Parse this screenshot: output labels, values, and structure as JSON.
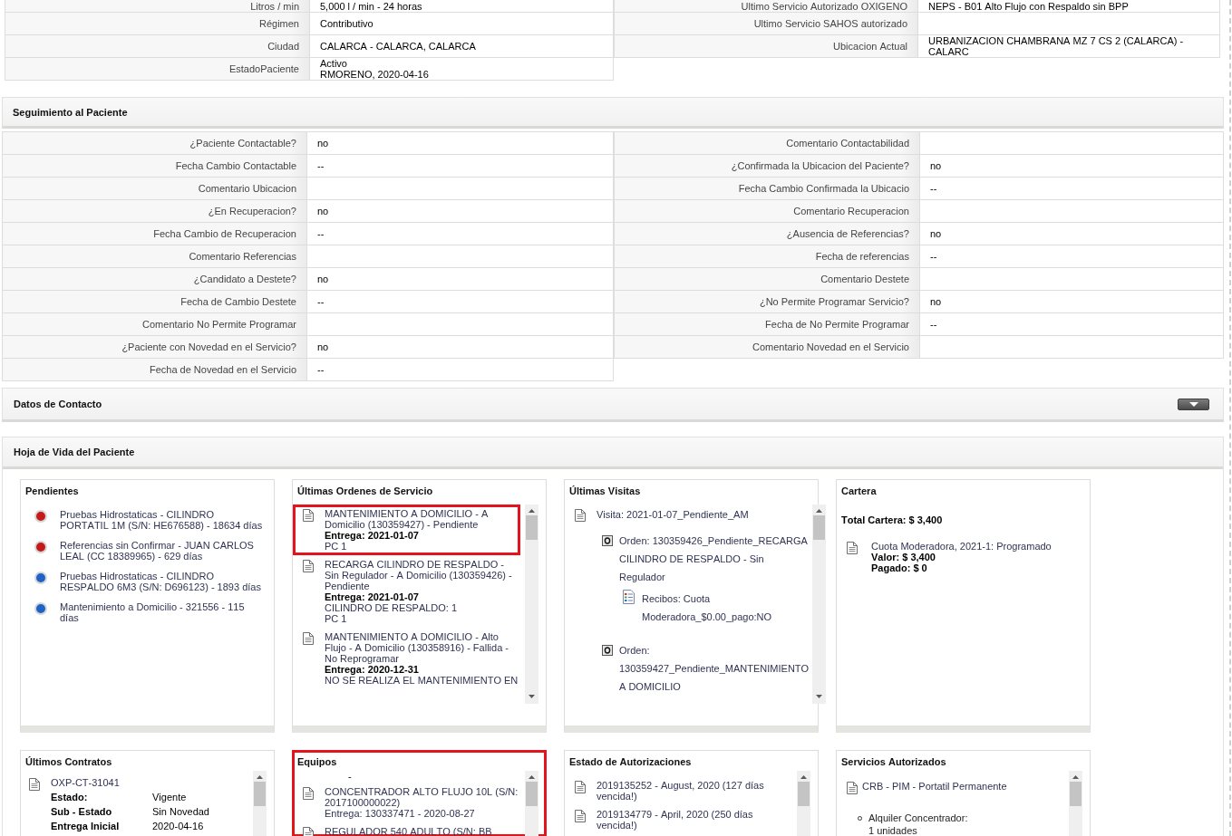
{
  "patient_info": {
    "left": [
      {
        "label": "Litros / min",
        "value": "5,000 l / min - 24 horas"
      },
      {
        "label": "Régimen",
        "value": "Contributivo"
      },
      {
        "label": "Ciudad",
        "value": "CALARCA - CALARCA, CALARCA"
      },
      {
        "label": "EstadoPaciente",
        "value": "Activo\nRMORENO, 2020-04-16"
      }
    ],
    "right": [
      {
        "label": "Ultimo Servicio Autorizado OXIGENO",
        "value": "NEPS - B01 Alto Flujo con Respaldo sin BPP"
      },
      {
        "label": "Ultimo Servicio SAHOS autorizado"
      },
      {
        "label": "Ubicacion Actual",
        "value": "URBANIZACION CHAMBRANA MZ 7 CS 2 (CALARCA) - CALARC"
      }
    ]
  },
  "seguimiento": {
    "title": "Seguimiento al Paciente",
    "left": [
      {
        "label": "¿Paciente Contactable?",
        "value": "no"
      },
      {
        "label": "Fecha Cambio Contactable",
        "value": "--"
      },
      {
        "label": "Comentario Ubicacion"
      },
      {
        "label": "¿En Recuperacion?",
        "value": "no"
      },
      {
        "label": "Fecha Cambio de Recuperacion",
        "value": "--"
      },
      {
        "label": "Comentario Referencias"
      },
      {
        "label": "¿Candidato a Destete?",
        "value": "no"
      },
      {
        "label": "Fecha de Cambio Destete",
        "value": "--"
      },
      {
        "label": "Comentario No Permite Programar"
      },
      {
        "label": "¿Paciente con Novedad en el Servicio?",
        "value": "no"
      },
      {
        "label": "Fecha de Novedad en el Servicio",
        "value": "--"
      }
    ],
    "right": [
      {
        "label": "Comentario Contactabilidad"
      },
      {
        "label": "¿Confirmada la Ubicacion del Paciente?",
        "value": "no"
      },
      {
        "label": "Fecha Cambio Confirmada la Ubicacio",
        "value": "--"
      },
      {
        "label": "Comentario Recuperacion"
      },
      {
        "label": "¿Ausencia de Referencias?",
        "value": "no"
      },
      {
        "label": "Fecha de referencias",
        "value": "--"
      },
      {
        "label": "Comentario Destete"
      },
      {
        "label": "¿No Permite Programar Servicio?",
        "value": "no"
      },
      {
        "label": "Fecha de No Permite Programar",
        "value": "--"
      },
      {
        "label": "Comentario Novedad en el Servicio"
      }
    ]
  },
  "datos_contacto": {
    "title": "Datos de Contacto",
    "expanded": false
  },
  "hoja_de_vida": {
    "title": "Hoja de Vida del Paciente",
    "panels": [
      {
        "title": "Pendientes",
        "kind": "status_list",
        "highlighted": false,
        "scrollable": false,
        "items": [
          {
            "text": "Pruebas Hidrostaticas - CILINDRO PORTATIL 1M (S/N: HE676588) - 18634 días",
            "color": "#c41a1a"
          },
          {
            "text": "Referencias sin Confirmar - JUAN CARLOS LEAL (CC 18389965) - 629 días",
            "color": "#c41a1a"
          },
          {
            "text": "Pruebas Hidrostaticas - CILINDRO RESPALDO 6M3 (S/N: D696123) - 1893 días",
            "color": "#1f63c6"
          },
          {
            "text": "Mantenimiento a Domicilio - 321556 - 115 días",
            "color": "#1f63c6"
          }
        ]
      },
      {
        "title": "Últimas Ordenes de Servicio",
        "kind": "document_list",
        "highlighted": false,
        "scrollable": true,
        "items": [
          {
            "title": "MANTENIMIENTO A DOMICILIO - A Domicilio (130359427) - Pendiente",
            "details": [
              {
                "text": "Entrega: 2021-01-07",
                "bold": true
              },
              {
                "text": "PC 1",
                "bold": false
              }
            ],
            "highlighted": true
          },
          {
            "title": "RECARGA CILINDRO DE RESPALDO - Sin Regulador - A Domicilio (130359426) - Pendiente",
            "details": [
              {
                "text": "Entrega: 2021-01-07",
                "bold": true
              },
              {
                "text": "CILINDRO DE RESPALDO: 1",
                "bold": false
              },
              {
                "text": "PC 1",
                "bold": false
              }
            ],
            "highlighted": false
          },
          {
            "title": "MANTENIMIENTO A DOMICILIO - Alto Flujo - A Domicilio (130358916) - Fallida - No Reprogramar",
            "details": [
              {
                "text": "Entrega: 2020-12-31",
                "bold": true
              },
              {
                "text": "NO SE REALIZA EL MANTENIMIENTO EN",
                "bold": false
              }
            ],
            "highlighted": false
          }
        ]
      },
      {
        "title": "Últimas Visitas",
        "kind": "visit_tree",
        "highlighted": false,
        "scrollable": true,
        "items": [
          {
            "kind": "visit",
            "text": "Visita: 2021-01-07_Pendiente_AM",
            "children": [
              {
                "kind": "order",
                "text": "Orden: 130359426_Pendiente_RECARGA CILINDRO DE RESPALDO - Sin Regulador",
                "children": [
                  {
                    "kind": "receipt",
                    "text": "Recibos: Cuota Moderadora_$0.00_pago:NO"
                  }
                ]
              },
              {
                "kind": "order",
                "text": "Orden: 130359427_Pendiente_MANTENIMIENTO A DOMICILIO"
              }
            ]
          }
        ]
      },
      {
        "title": "Cartera",
        "kind": "balance",
        "highlighted": false,
        "scrollable": false,
        "total": "Total Cartera: $ 3,400",
        "items": [
          {
            "title": "Cuota Moderadora, 2021-1: Programado",
            "details": [
              {
                "text": "Valor: $ 3,400",
                "bold": true
              },
              {
                "text": "Pagado: $ 0",
                "bold": true
              }
            ]
          }
        ]
      },
      {
        "title": "Últimos Contratos",
        "kind": "contract_list",
        "highlighted": false,
        "scrollable": true,
        "items": [
          {
            "title": "OXP-CT-31041",
            "fields": [
              {
                "label": "Estado:",
                "value": "Vigente"
              },
              {
                "label": "Sub - Estado",
                "value": "Sin Novedad"
              },
              {
                "label": "Entrega Inicial",
                "value": "2020-04-16"
              }
            ]
          }
        ]
      },
      {
        "title": "Equipos",
        "kind": "document_list",
        "highlighted": true,
        "scrollable": true,
        "note": "-",
        "items": [
          {
            "title": "CONCENTRADOR ALTO FLUJO 10L (S/N: 2017100000022)",
            "details": [
              {
                "text": "Entrega: 130337471 - 2020-08-27",
                "bold": false
              }
            ],
            "highlighted": false
          },
          {
            "title": "REGULADOR 540 ADULTO (S/N: BB",
            "highlighted": false
          }
        ]
      },
      {
        "title": "Estado de Autorizaciones",
        "kind": "document_list",
        "highlighted": false,
        "scrollable": true,
        "items": [
          {
            "title": "2019135252 - August, 2020 (127 días vencida!)",
            "highlighted": false
          },
          {
            "title": "2019134779 - April, 2020 (250 días vencida!)",
            "highlighted": false
          }
        ]
      },
      {
        "title": "Servicios Autorizados",
        "kind": "service_list",
        "highlighted": false,
        "scrollable": true,
        "items": [
          {
            "title": "CRB - PIM - Portatil Permanente",
            "bullets": [
              "Alquiler Concentrador:\n1 unidades"
            ]
          }
        ]
      }
    ]
  }
}
